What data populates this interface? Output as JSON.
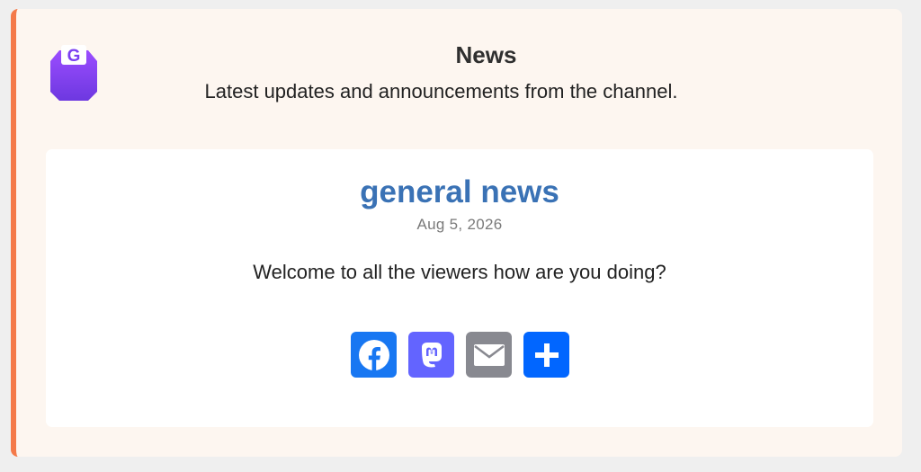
{
  "widget": {
    "logo_letter": "G",
    "title": "News",
    "subtitle": "Latest updates and announcements from the channel.",
    "accent_color": "#f47a4a"
  },
  "post": {
    "title": "general news",
    "date": "Aug 5, 2026",
    "body": "Welcome to all the viewers how are you doing?"
  },
  "share_buttons": [
    {
      "icon": "facebook-icon",
      "color": "#1877f2"
    },
    {
      "icon": "mastodon-icon",
      "color": "#6364ff"
    },
    {
      "icon": "email-icon",
      "color": "#888990"
    },
    {
      "icon": "share-icon",
      "color": "#0166ff"
    }
  ]
}
